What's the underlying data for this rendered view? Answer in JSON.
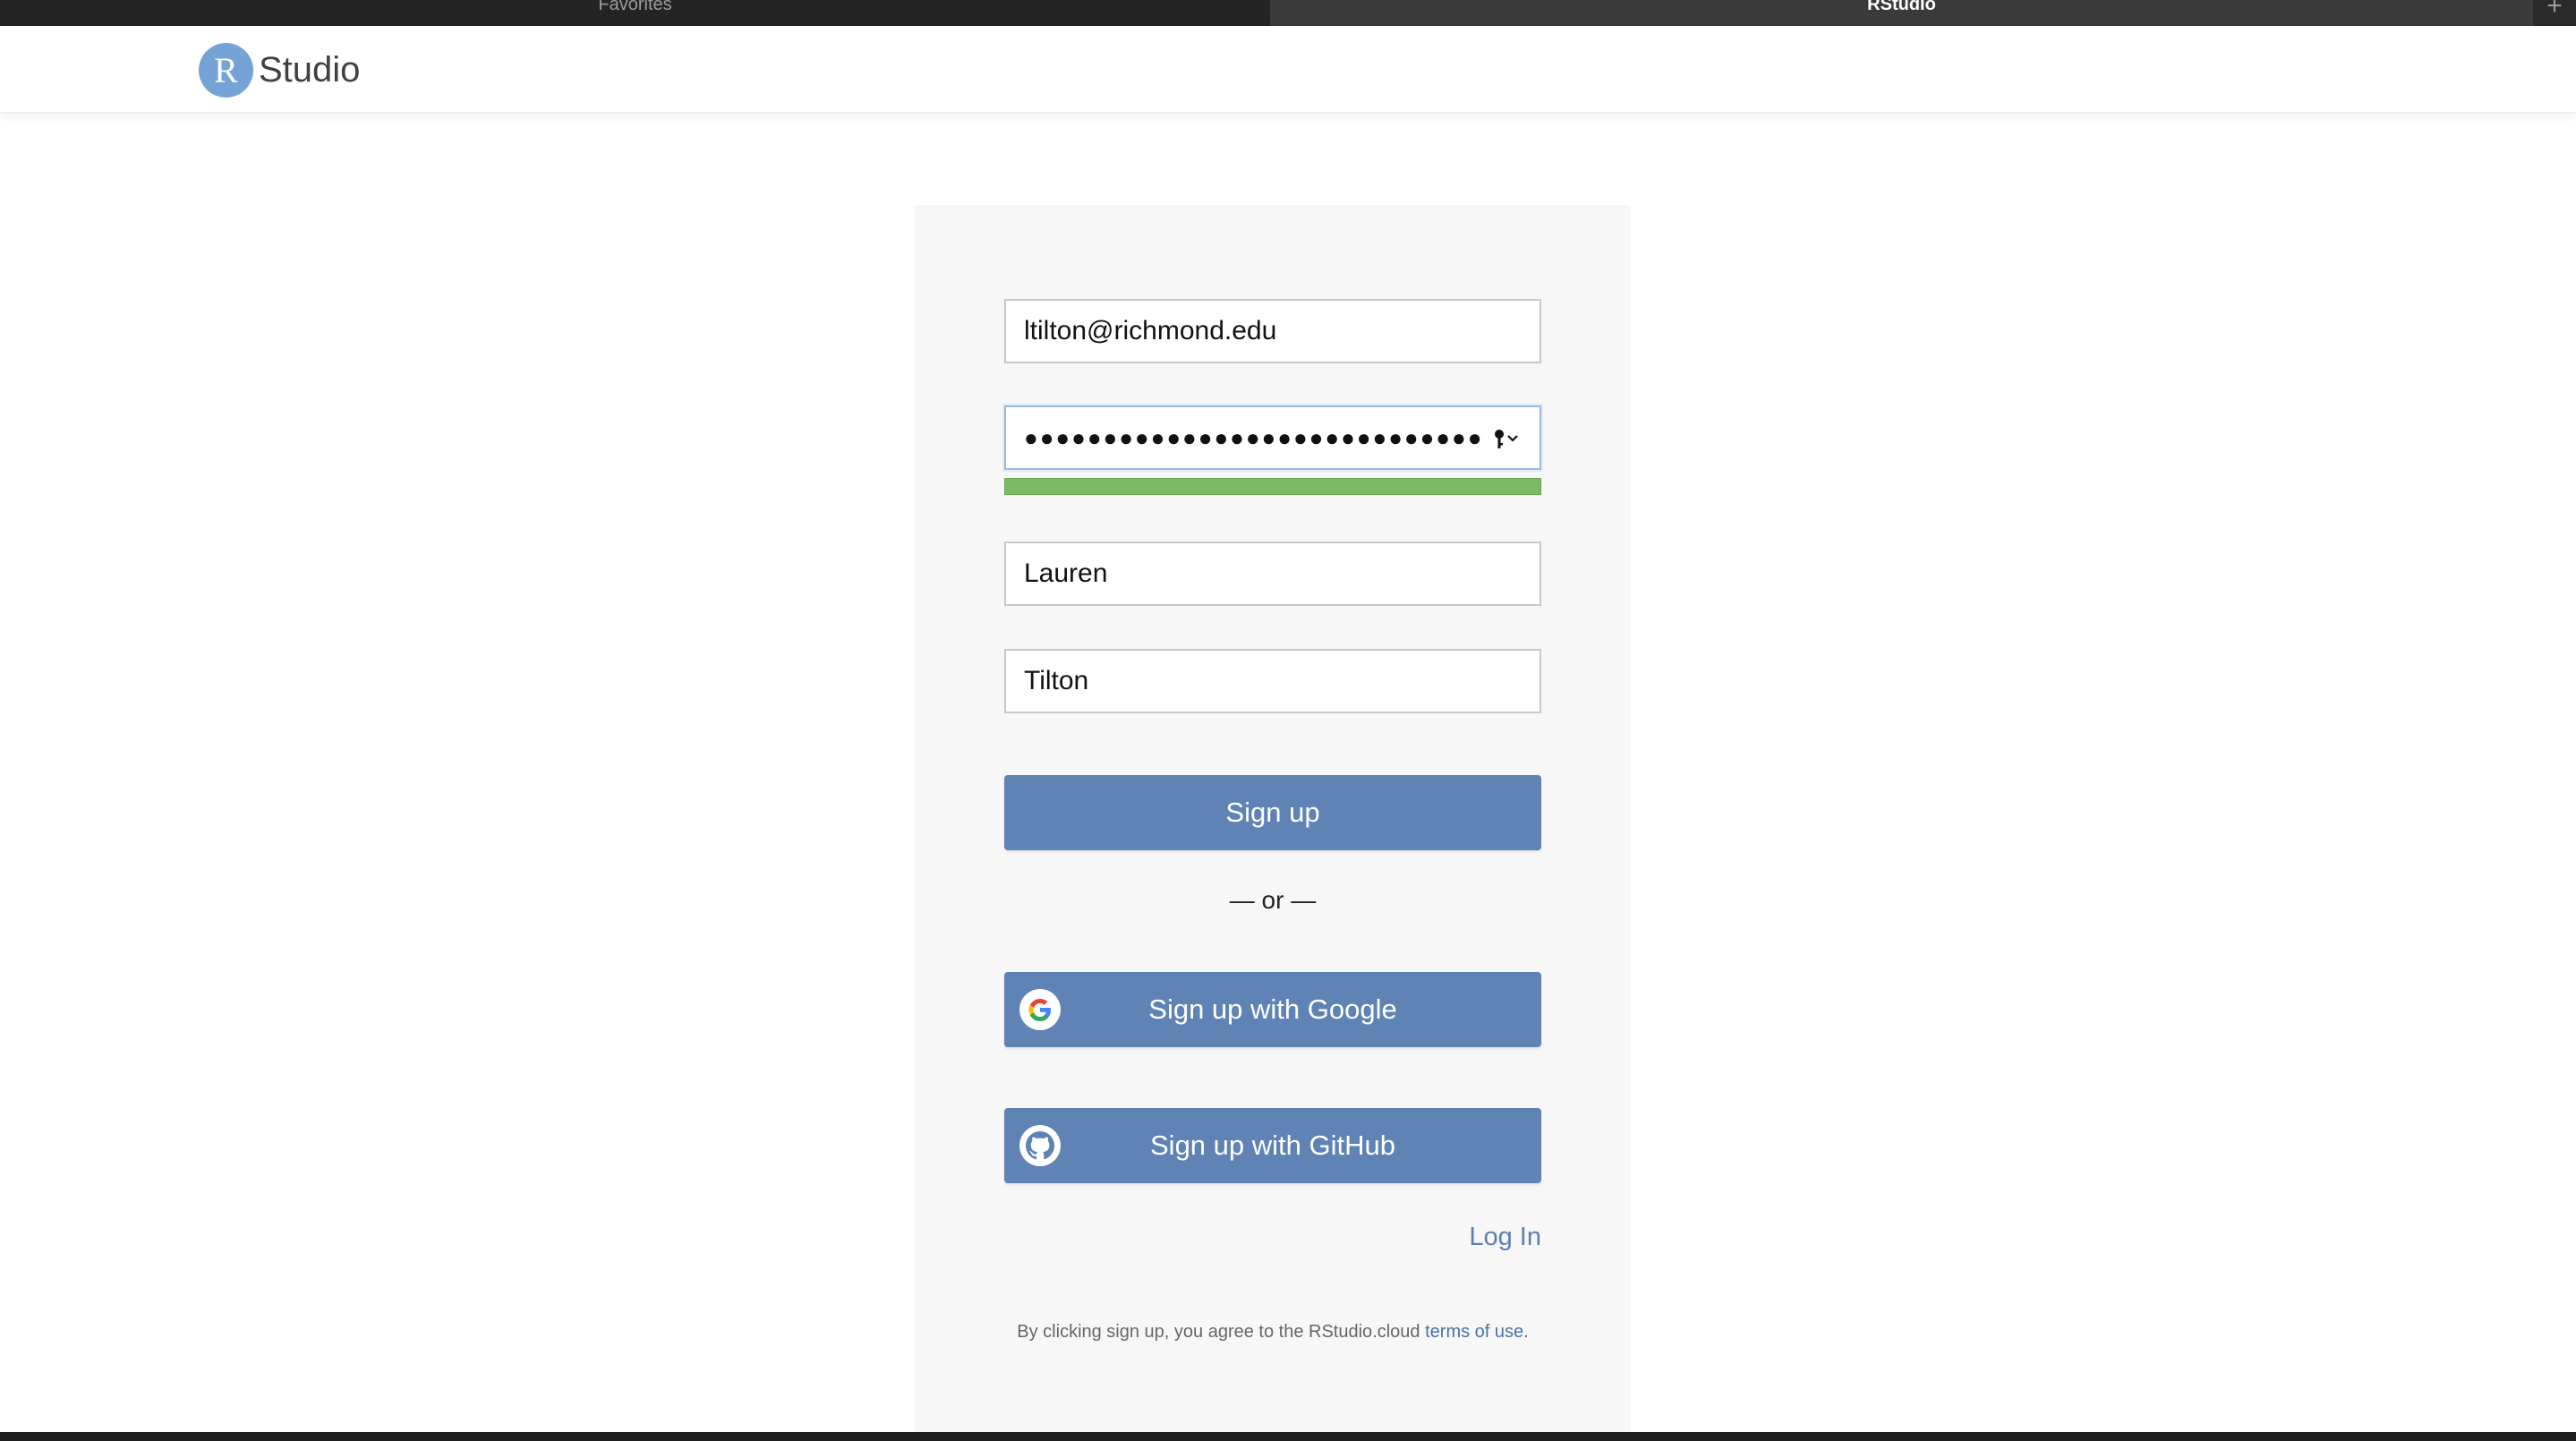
{
  "browser": {
    "tabs": [
      {
        "label": "Favorites"
      },
      {
        "label": "RStudio"
      }
    ],
    "new_tab_symbol": "+"
  },
  "header": {
    "logo_letter": "R",
    "logo_text": "Studio",
    "logo_color": "#75a3d6"
  },
  "form": {
    "email_value": "ltilton@richmond.edu",
    "password_mask": "●●●●●●●●●●●●●●●●●●●●●●●●●●●●●",
    "password_strength": 1.0,
    "password_strength_color": "#7cba66",
    "first_name_value": "Lauren",
    "last_name_value": "Tilton",
    "signup_label": "Sign up",
    "or_label": "— or —",
    "google_label": "Sign up with Google",
    "github_label": "Sign up with GitHub",
    "login_label": "Log In",
    "terms_prefix": "By clicking sign up, you agree to the RStudio.cloud ",
    "terms_link": "terms of use",
    "terms_suffix": "."
  },
  "colors": {
    "button": "#5f83b5",
    "link": "#5b7fae"
  },
  "icons": {
    "google": "google-logo-icon",
    "github": "github-logo-icon",
    "password_key": "key-icon"
  }
}
